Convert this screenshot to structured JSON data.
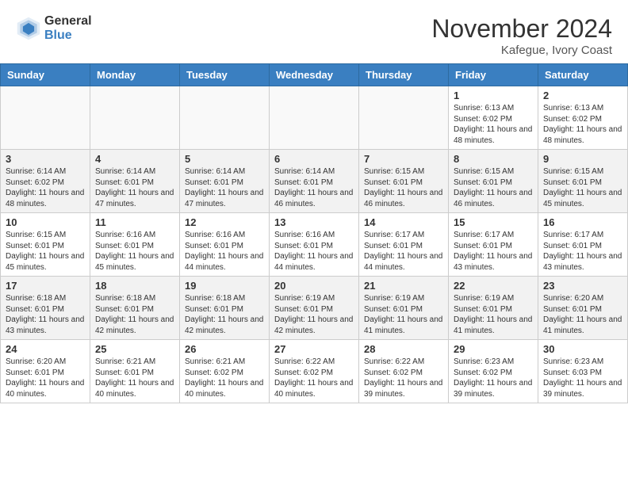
{
  "header": {
    "logo_general": "General",
    "logo_blue": "Blue",
    "month_title": "November 2024",
    "location": "Kafegue, Ivory Coast"
  },
  "weekdays": [
    "Sunday",
    "Monday",
    "Tuesday",
    "Wednesday",
    "Thursday",
    "Friday",
    "Saturday"
  ],
  "weeks": [
    [
      {
        "num": "",
        "info": ""
      },
      {
        "num": "",
        "info": ""
      },
      {
        "num": "",
        "info": ""
      },
      {
        "num": "",
        "info": ""
      },
      {
        "num": "",
        "info": ""
      },
      {
        "num": "1",
        "info": "Sunrise: 6:13 AM\nSunset: 6:02 PM\nDaylight: 11 hours and 48 minutes."
      },
      {
        "num": "2",
        "info": "Sunrise: 6:13 AM\nSunset: 6:02 PM\nDaylight: 11 hours and 48 minutes."
      }
    ],
    [
      {
        "num": "3",
        "info": "Sunrise: 6:14 AM\nSunset: 6:02 PM\nDaylight: 11 hours and 48 minutes."
      },
      {
        "num": "4",
        "info": "Sunrise: 6:14 AM\nSunset: 6:01 PM\nDaylight: 11 hours and 47 minutes."
      },
      {
        "num": "5",
        "info": "Sunrise: 6:14 AM\nSunset: 6:01 PM\nDaylight: 11 hours and 47 minutes."
      },
      {
        "num": "6",
        "info": "Sunrise: 6:14 AM\nSunset: 6:01 PM\nDaylight: 11 hours and 46 minutes."
      },
      {
        "num": "7",
        "info": "Sunrise: 6:15 AM\nSunset: 6:01 PM\nDaylight: 11 hours and 46 minutes."
      },
      {
        "num": "8",
        "info": "Sunrise: 6:15 AM\nSunset: 6:01 PM\nDaylight: 11 hours and 46 minutes."
      },
      {
        "num": "9",
        "info": "Sunrise: 6:15 AM\nSunset: 6:01 PM\nDaylight: 11 hours and 45 minutes."
      }
    ],
    [
      {
        "num": "10",
        "info": "Sunrise: 6:15 AM\nSunset: 6:01 PM\nDaylight: 11 hours and 45 minutes."
      },
      {
        "num": "11",
        "info": "Sunrise: 6:16 AM\nSunset: 6:01 PM\nDaylight: 11 hours and 45 minutes."
      },
      {
        "num": "12",
        "info": "Sunrise: 6:16 AM\nSunset: 6:01 PM\nDaylight: 11 hours and 44 minutes."
      },
      {
        "num": "13",
        "info": "Sunrise: 6:16 AM\nSunset: 6:01 PM\nDaylight: 11 hours and 44 minutes."
      },
      {
        "num": "14",
        "info": "Sunrise: 6:17 AM\nSunset: 6:01 PM\nDaylight: 11 hours and 44 minutes."
      },
      {
        "num": "15",
        "info": "Sunrise: 6:17 AM\nSunset: 6:01 PM\nDaylight: 11 hours and 43 minutes."
      },
      {
        "num": "16",
        "info": "Sunrise: 6:17 AM\nSunset: 6:01 PM\nDaylight: 11 hours and 43 minutes."
      }
    ],
    [
      {
        "num": "17",
        "info": "Sunrise: 6:18 AM\nSunset: 6:01 PM\nDaylight: 11 hours and 43 minutes."
      },
      {
        "num": "18",
        "info": "Sunrise: 6:18 AM\nSunset: 6:01 PM\nDaylight: 11 hours and 42 minutes."
      },
      {
        "num": "19",
        "info": "Sunrise: 6:18 AM\nSunset: 6:01 PM\nDaylight: 11 hours and 42 minutes."
      },
      {
        "num": "20",
        "info": "Sunrise: 6:19 AM\nSunset: 6:01 PM\nDaylight: 11 hours and 42 minutes."
      },
      {
        "num": "21",
        "info": "Sunrise: 6:19 AM\nSunset: 6:01 PM\nDaylight: 11 hours and 41 minutes."
      },
      {
        "num": "22",
        "info": "Sunrise: 6:19 AM\nSunset: 6:01 PM\nDaylight: 11 hours and 41 minutes."
      },
      {
        "num": "23",
        "info": "Sunrise: 6:20 AM\nSunset: 6:01 PM\nDaylight: 11 hours and 41 minutes."
      }
    ],
    [
      {
        "num": "24",
        "info": "Sunrise: 6:20 AM\nSunset: 6:01 PM\nDaylight: 11 hours and 40 minutes."
      },
      {
        "num": "25",
        "info": "Sunrise: 6:21 AM\nSunset: 6:01 PM\nDaylight: 11 hours and 40 minutes."
      },
      {
        "num": "26",
        "info": "Sunrise: 6:21 AM\nSunset: 6:02 PM\nDaylight: 11 hours and 40 minutes."
      },
      {
        "num": "27",
        "info": "Sunrise: 6:22 AM\nSunset: 6:02 PM\nDaylight: 11 hours and 40 minutes."
      },
      {
        "num": "28",
        "info": "Sunrise: 6:22 AM\nSunset: 6:02 PM\nDaylight: 11 hours and 39 minutes."
      },
      {
        "num": "29",
        "info": "Sunrise: 6:23 AM\nSunset: 6:02 PM\nDaylight: 11 hours and 39 minutes."
      },
      {
        "num": "30",
        "info": "Sunrise: 6:23 AM\nSunset: 6:03 PM\nDaylight: 11 hours and 39 minutes."
      }
    ]
  ]
}
